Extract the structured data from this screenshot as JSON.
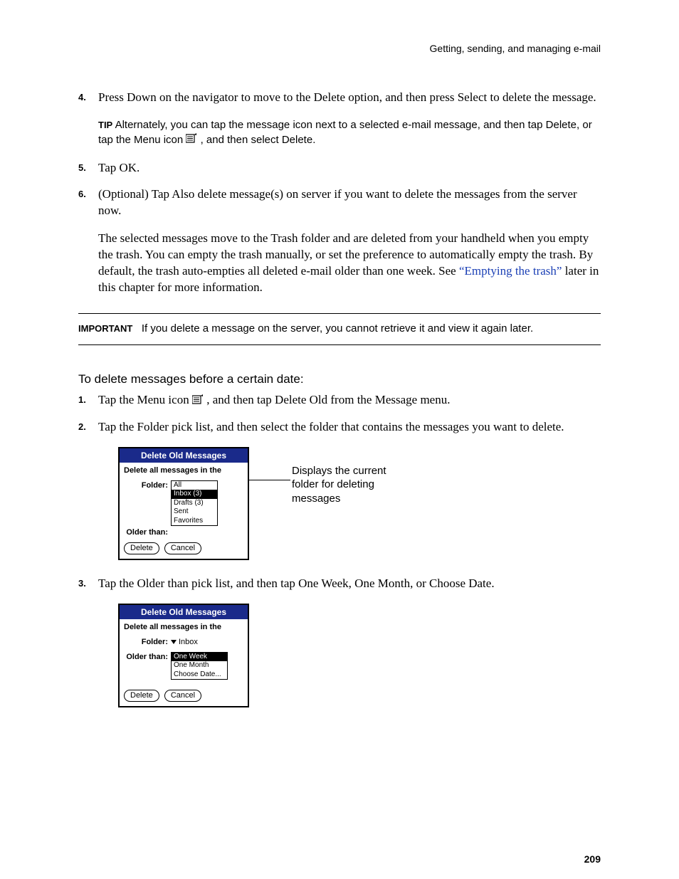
{
  "running_header": "Getting, sending, and managing e-mail",
  "page_number": "209",
  "steps_a": {
    "s4": {
      "num": "4.",
      "text": "Press Down on the navigator to move to the Delete option, and then press Select to delete the message."
    },
    "tip": {
      "label": "TIP",
      "part1": "Alternately, you can tap the message icon next to a selected e-mail message, and then tap Delete, or tap the Menu icon ",
      "part2": ", and then select Delete."
    },
    "s5": {
      "num": "5.",
      "text": "Tap OK."
    },
    "s6": {
      "num": "6.",
      "text1": "(Optional) Tap Also delete message(s) on server if you want to delete the messages from the server now.",
      "text2a": "The selected messages move to the Trash folder and are deleted from your handheld when you empty the trash. You can empty the trash manually, or set the preference to automatically empty the trash. By default, the trash auto-empties all deleted e-mail older than one week. See ",
      "link": "“Emptying the trash”",
      "text2b": " later in this chapter for more information."
    }
  },
  "important": {
    "label": "IMPORTANT",
    "text": "If you delete a message on the server, you cannot retrieve it and view it again later."
  },
  "section_head": "To delete messages before a certain date:",
  "steps_b": {
    "s1": {
      "num": "1.",
      "text_a": "Tap the Menu icon ",
      "text_b": ", and then tap Delete Old from the Message menu."
    },
    "s2": {
      "num": "2.",
      "text": "Tap the Folder pick list, and then select the folder that contains the messages you want to delete."
    },
    "s3": {
      "num": "3.",
      "text": "Tap the Older than pick list, and then tap One Week, One Month, or Choose Date."
    }
  },
  "dialog1": {
    "title": "Delete Old Messages",
    "headline": "Delete all messages in the",
    "folder_label": "Folder:",
    "older_label": "Older than:",
    "folder_options": [
      "All",
      "Inbox (3)",
      "Drafts (3)",
      "Sent",
      "Favorites"
    ],
    "btn_delete": "Delete",
    "btn_cancel": "Cancel"
  },
  "callout1": "Displays the current folder for deleting messages",
  "dialog2": {
    "title": "Delete Old Messages",
    "headline": "Delete all messages in the",
    "folder_label": "Folder:",
    "folder_value": "Inbox",
    "older_label": "Older than:",
    "older_options": [
      "One Week",
      "One Month",
      "Choose Date..."
    ],
    "btn_delete": "Delete",
    "btn_cancel": "Cancel"
  }
}
